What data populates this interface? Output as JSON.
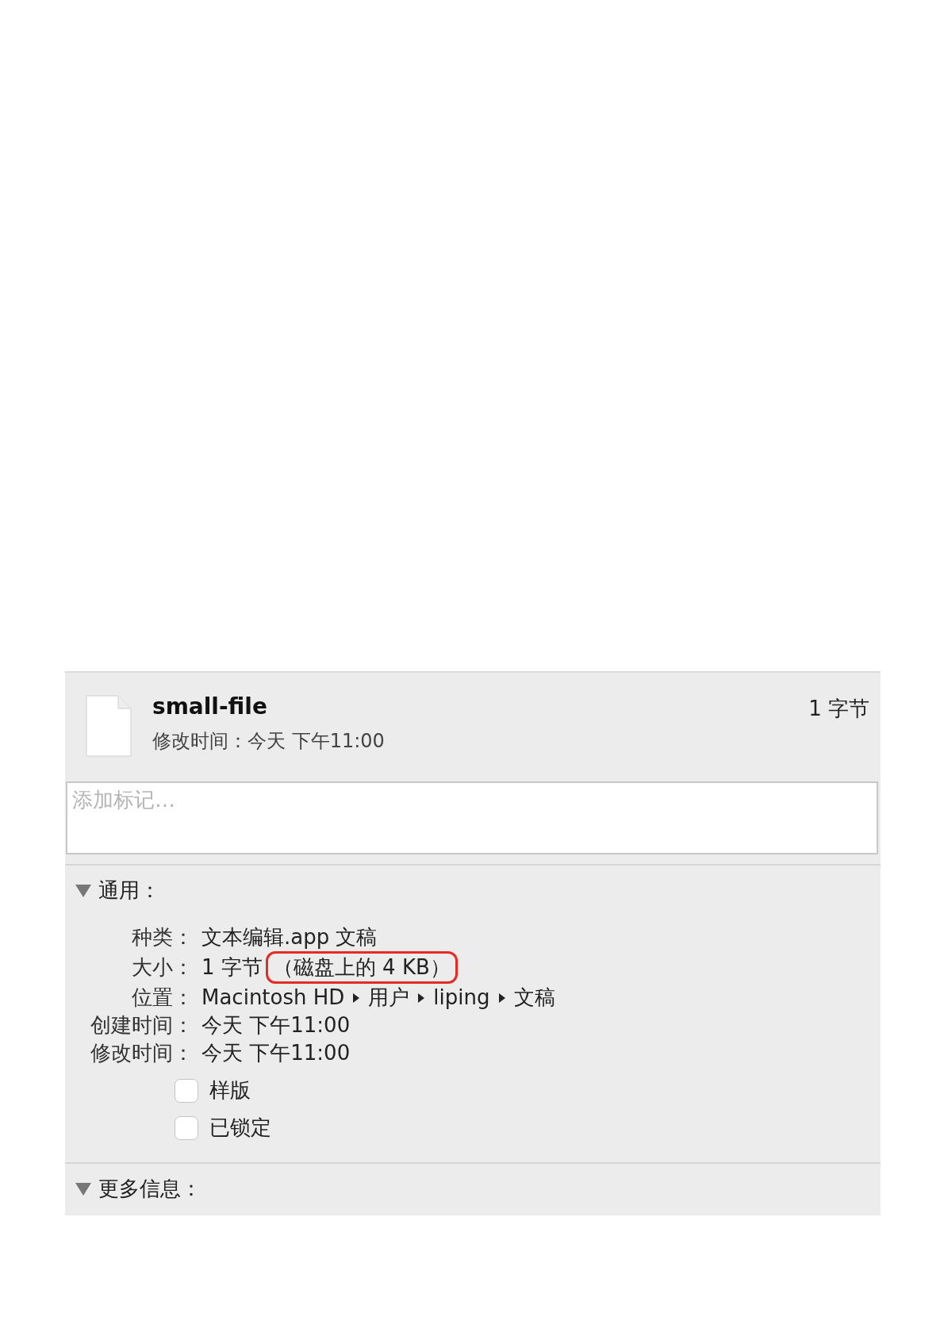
{
  "header": {
    "file_name": "small-file",
    "modified": "修改时间：今天 下午11:00",
    "size": "1 字节"
  },
  "tags": {
    "placeholder": "添加标记…"
  },
  "sections": [
    {
      "title": "通用：",
      "expanded": true,
      "rows": [
        {
          "kind": "text",
          "label": "种类：",
          "value": "文本编辑.app 文稿"
        },
        {
          "kind": "size",
          "label": "大小：",
          "value": "1 字节",
          "extra": "（磁盘上的 4 KB）",
          "highlighted": true
        },
        {
          "kind": "path",
          "label": "位置：",
          "path": [
            "Macintosh HD",
            "用户",
            "liping",
            "文稿"
          ]
        },
        {
          "kind": "text",
          "label": "创建时间：",
          "value": "今天 下午11:00"
        },
        {
          "kind": "text",
          "label": "修改时间：",
          "value": "今天 下午11:00"
        },
        {
          "kind": "check",
          "label": "样版",
          "checked": false
        },
        {
          "kind": "check",
          "label": "已锁定",
          "checked": false
        }
      ]
    },
    {
      "title": "更多信息：",
      "expanded": true
    }
  ]
}
